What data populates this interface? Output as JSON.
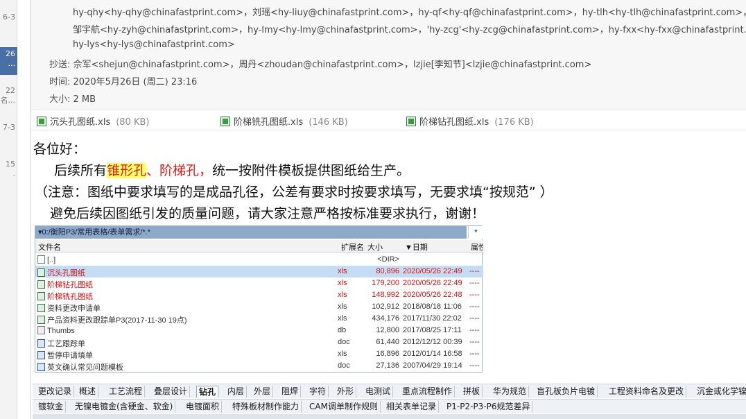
{
  "left_list": [
    {
      "text": "6-3",
      "selected": false
    },
    {
      "text": "26\n...",
      "selected": true
    },
    {
      "text": "22\n名...",
      "selected": false
    },
    {
      "text": "7-3",
      "selected": false
    },
    {
      "text": "15\n.",
      "selected": false
    }
  ],
  "header": {
    "recipients_lines": [
      "hy-qhy<hy-qhy@chinafastprint.com>，刘瑶<hy-liuy@chinafastprint.com>，hy-qf<hy-qf@chinafastprint.com>，hy-tlh<hy-tlh@chinafastprint.com>，hy-che",
      "邹宇航<hy-zyh@chinafastprint.com>，hy-lmy<hy-lmy@chinafastprint.com>，'hy-zcg'<hy-zcg@chinafastprint.com>，hy-fxx<hy-fxx@chinafastprint.com>，",
      "hy-lys<hy-lys@chinafastprint.com>"
    ],
    "cc_label": "抄送:",
    "cc_value": "佘军<shejun@chinafastprint.com>，周丹<zhoudan@chinafastprint.com>，lzjie[李知节]<lzjie@chinafastprint.com>",
    "time_label": "时间:",
    "time_value": "2020年5月26日 (周二) 23:16",
    "size_label": "大小:",
    "size_value": "2 MB"
  },
  "attachments": [
    {
      "name": "沉头孔图纸.xls",
      "size": "(80 KB)"
    },
    {
      "name": "阶梯铣孔图纸.xls",
      "size": "(146 KB)"
    },
    {
      "name": "阶梯钻孔图纸.xls",
      "size": "(176 KB)"
    }
  ],
  "body": {
    "greeting": "各位好：",
    "line2_a": "后续所有",
    "line2_hl": "锥形孔",
    "line2_sep": "、阶梯孔，",
    "line2_b": "统一按附件模板提供图纸给生产。",
    "line3": "（注意：图纸中要求填写的是成品孔径，公差有要求时按要求填写，无要求填“按规范” ）",
    "line4": "避免后续因图纸引发的质量问题，请大家注意严格按标准要求执行，谢谢！"
  },
  "file_manager": {
    "path": "▾0:/衡阳P3/常用表格/表单需求/*.*",
    "star": "*",
    "columns": {
      "name": "文件名",
      "ext": "扩展名",
      "size": "大小",
      "date": "▼日期",
      "attr": "属性"
    },
    "rows": [
      {
        "name": "[..]",
        "ext": "",
        "size": "<DIR>",
        "date": "",
        "attr": "",
        "icon": "up",
        "red": false,
        "sel": false
      },
      {
        "name": "沉头孔图纸",
        "ext": "xls",
        "size": "80,896",
        "date": "2020/05/26 22:49",
        "attr": "----",
        "icon": "xls",
        "red": true,
        "sel": true
      },
      {
        "name": "阶梯钻孔图纸",
        "ext": "xls",
        "size": "179,200",
        "date": "2020/05/26 22:49",
        "attr": "----",
        "icon": "xls",
        "red": true,
        "sel": false
      },
      {
        "name": "阶梯铣孔图纸",
        "ext": "xls",
        "size": "148,992",
        "date": "2020/05/26 22:48",
        "attr": "----",
        "icon": "xls",
        "red": true,
        "sel": false
      },
      {
        "name": "资料更改申请单",
        "ext": "xls",
        "size": "102,912",
        "date": "2018/08/18 11:06",
        "attr": "----",
        "icon": "xls",
        "red": false,
        "sel": false
      },
      {
        "name": "产品资料更改跟踪单P3(2017-11-30 19点)",
        "ext": "xls",
        "size": "434,176",
        "date": "2017/11/30 22:02",
        "attr": "----",
        "icon": "xls",
        "red": false,
        "sel": false
      },
      {
        "name": "Thumbs",
        "ext": "db",
        "size": "12,800",
        "date": "2017/08/25 17:11",
        "attr": "----",
        "icon": "db",
        "red": false,
        "sel": false
      },
      {
        "name": "工艺跟踪单",
        "ext": "doc",
        "size": "61,440",
        "date": "2012/12/12 00:39",
        "attr": "----",
        "icon": "doc",
        "red": false,
        "sel": false
      },
      {
        "name": "暂停申请填单",
        "ext": "xls",
        "size": "16,896",
        "date": "2012/01/14 16:58",
        "attr": "----",
        "icon": "doc",
        "red": false,
        "sel": false
      },
      {
        "name": "英文确认常见问题模板",
        "ext": "doc",
        "size": "27,136",
        "date": "2007/04/29 19:14",
        "attr": "----",
        "icon": "doc",
        "red": false,
        "sel": false
      }
    ]
  },
  "tabs_row1": [
    "更改记录",
    "概述",
    "工艺流程",
    "叠层设计",
    "钻孔",
    "内层",
    "外层",
    "阻焊",
    "字符",
    "外形",
    "电测试",
    "重点流程制作",
    "拼板",
    "华为规范",
    "盲孔板负片电镀",
    "工程资料命名及更改",
    "沉金或化学镍"
  ],
  "tabs_row1_active": 4,
  "tabs_row2": [
    "镀软金",
    "无镍电镀金(含硬金、软金)",
    "电镀面积",
    "特殊板材制作能力",
    "CAM调单制作规则",
    "相关表单记录",
    "P1-P2-P3-P6规范差异"
  ]
}
